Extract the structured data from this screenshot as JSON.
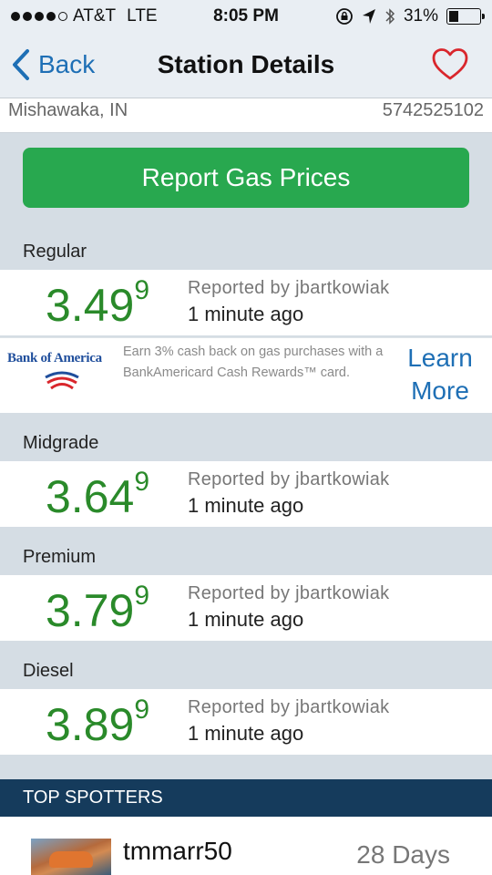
{
  "status_bar": {
    "carrier": "AT&T",
    "network": "LTE",
    "time": "8:05 PM",
    "battery": "31%",
    "battery_level": 0.31,
    "signal_bars_filled": 4,
    "signal_bars_total": 5
  },
  "nav": {
    "back_label": "Back",
    "title": "Station Details"
  },
  "station": {
    "city": "Mishawaka, IN",
    "phone": "5742525102"
  },
  "report_button": "Report Gas Prices",
  "prices": [
    {
      "grade": "Regular",
      "price_main": "3.49",
      "price_tenth": "9",
      "reporter": "Reported by jbartkowiak",
      "time": "1 minute ago"
    },
    {
      "grade": "Midgrade",
      "price_main": "3.64",
      "price_tenth": "9",
      "reporter": "Reported by jbartkowiak",
      "time": "1 minute ago"
    },
    {
      "grade": "Premium",
      "price_main": "3.79",
      "price_tenth": "9",
      "reporter": "Reported by jbartkowiak",
      "time": "1 minute ago"
    },
    {
      "grade": "Diesel",
      "price_main": "3.89",
      "price_tenth": "9",
      "reporter": "Reported by jbartkowiak",
      "time": "1 minute ago"
    }
  ],
  "ad": {
    "brand": "Bank of America",
    "text": "Earn 3% cash back on gas purchases with a BankAmericard Cash Rewards™ card.",
    "cta_line1": "Learn",
    "cta_line2": "More"
  },
  "top_spotters": {
    "heading": "TOP SPOTTERS",
    "entries": [
      {
        "name": "tmmarr50",
        "days": "28 Days"
      }
    ]
  },
  "colors": {
    "accent_blue": "#1e6fb5",
    "price_green": "#2a8a2a",
    "button_green": "#28a84f",
    "heart_red": "#d9262c",
    "spotters_header": "#153b5c"
  }
}
